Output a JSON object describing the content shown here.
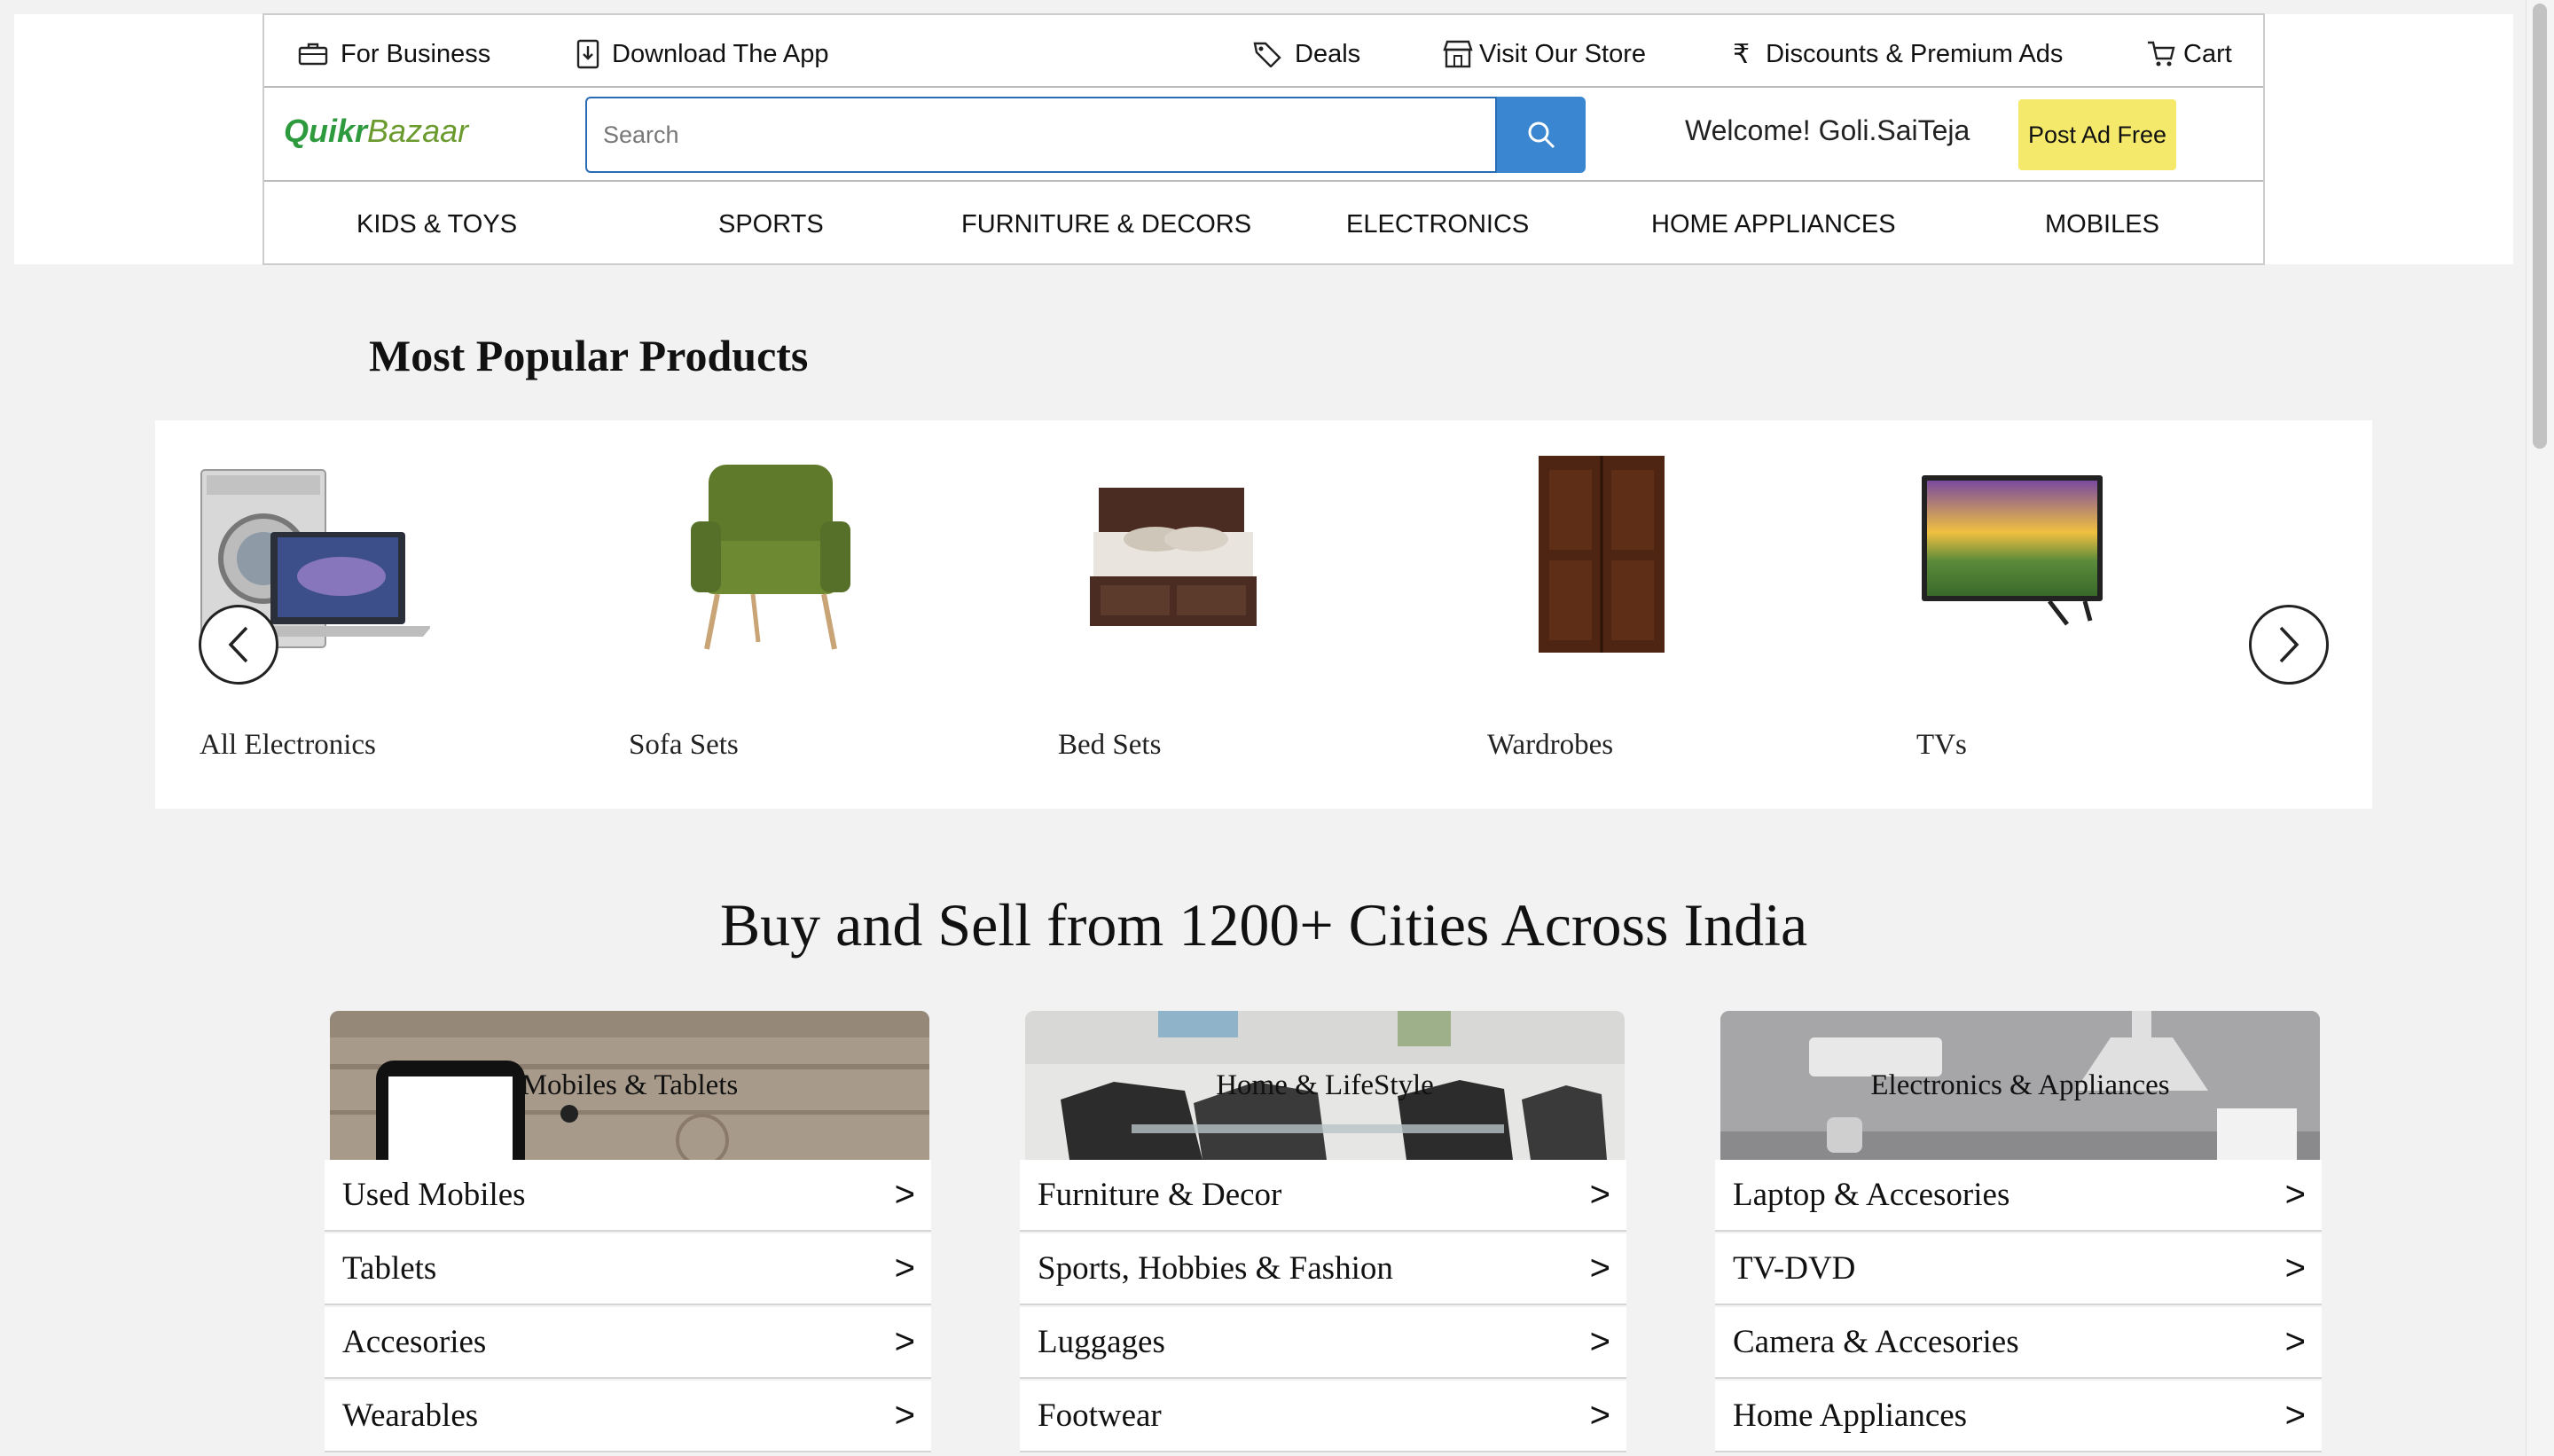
{
  "topbar": {
    "for_business": "For Business",
    "download_app": "Download The App",
    "deals": "Deals",
    "visit_store": "Visit Our Store",
    "discounts": "Discounts & Premium Ads",
    "cart": "Cart"
  },
  "header": {
    "logo_quikr": "Quikr",
    "logo_bazaar": "Bazaar",
    "search_placeholder": "Search",
    "welcome": "Welcome! Goli.SaiTeja",
    "post_ad": "Post Ad Free"
  },
  "nav": [
    "KIDS & TOYS",
    "SPORTS",
    "FURNITURE & DECORS",
    "ELECTRONICS",
    "HOME APPLIANCES",
    "MOBILES"
  ],
  "popular": {
    "title": "Most Popular Products",
    "items": [
      "All Electronics",
      "Sofa Sets",
      "Bed Sets",
      "Wardrobes",
      "TVs"
    ]
  },
  "cities_title": "Buy and Sell from 1200+ Cities Across India",
  "categories": [
    {
      "title": "Mobiles & Tablets",
      "items": [
        "Used Mobiles",
        "Tablets",
        "Accesories",
        "Wearables"
      ]
    },
    {
      "title": "Home & LifeStyle",
      "items": [
        "Furniture & Decor",
        "Sports, Hobbies & Fashion",
        "Luggages",
        "Footwear"
      ]
    },
    {
      "title": "Electronics & Appliances",
      "items": [
        "Laptop & Accesories",
        "TV-DVD",
        "Camera & Accesories",
        "Home Appliances"
      ]
    }
  ],
  "row_arrow": ">",
  "colors": {
    "search_blue": "#3a86d0",
    "post_ad_yellow": "#f5e96b",
    "logo_green": "#2e9a3e"
  }
}
